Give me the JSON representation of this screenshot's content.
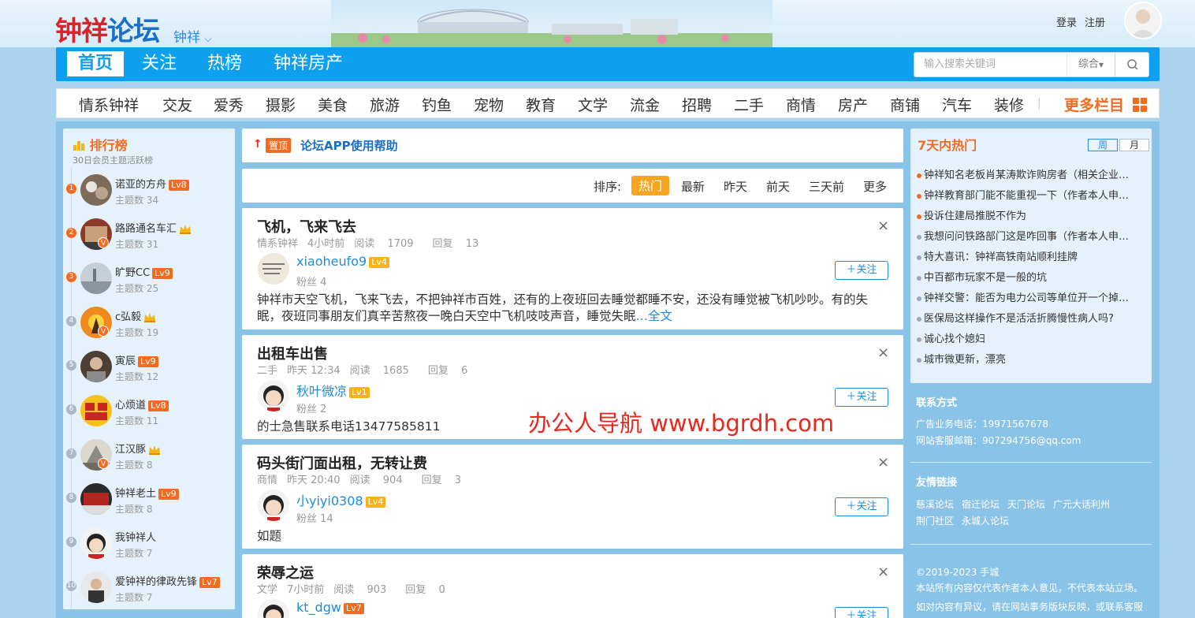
{
  "site": {
    "logo_a": "钟祥",
    "logo_b": "论坛",
    "city": "钟祥"
  },
  "user_links": {
    "login": "登录",
    "register": "注册"
  },
  "nav": {
    "items": [
      "首页",
      "关注",
      "热榜",
      "钟祥房产"
    ]
  },
  "search": {
    "placeholder": "输入搜索关键词",
    "scope": "综合"
  },
  "categories": [
    "情系钟祥",
    "交友",
    "爱秀",
    "摄影",
    "美食",
    "旅游",
    "钓鱼",
    "宠物",
    "教育",
    "文学",
    "流金",
    "招聘",
    "二手",
    "商情",
    "房产",
    "商铺",
    "汽车",
    "装修"
  ],
  "more_label": "更多栏目",
  "rank": {
    "title": "排行榜",
    "subtitle": "30日会员主题活跃榜",
    "count_label": "主题数",
    "items": [
      {
        "num": "1",
        "name": "诺亚的方舟",
        "lv": "Lv8",
        "count": "34"
      },
      {
        "num": "2",
        "name": "路路通名车汇",
        "lv": "",
        "count": "31"
      },
      {
        "num": "3",
        "name": "旷野CC",
        "lv": "Lv9",
        "count": "25"
      },
      {
        "num": "4",
        "name": "c弘毅",
        "lv": "",
        "count": "19"
      },
      {
        "num": "5",
        "name": "寅辰",
        "lv": "Lv9",
        "count": "12"
      },
      {
        "num": "6",
        "name": "心烦道",
        "lv": "Lv8",
        "count": "11"
      },
      {
        "num": "7",
        "name": "江汉豚",
        "lv": "",
        "count": "8"
      },
      {
        "num": "8",
        "name": "钟祥老土",
        "lv": "Lv9",
        "count": "8"
      },
      {
        "num": "9",
        "name": "我钟祥人",
        "lv": "",
        "count": "7"
      },
      {
        "num": "10",
        "name": "爱钟祥的律政先锋",
        "lv": "Lv7",
        "count": "7"
      }
    ]
  },
  "pinned": {
    "tag": "置顶",
    "title": "论坛APP使用帮助"
  },
  "sort": {
    "label": "排序:",
    "items": [
      "热门",
      "最新",
      "昨天",
      "前天",
      "三天前",
      "更多"
    ]
  },
  "follow_label": "关注",
  "fans_label": "粉丝",
  "read_label": "阅读",
  "reply_label": "回复",
  "posts": [
    {
      "title": "飞机，飞来飞去",
      "cat": "情系钟祥",
      "time": "4小时前",
      "reads": "1709",
      "replies": "13",
      "author": "xiaoheufo9",
      "lv": "Lv4",
      "fans": "4",
      "body": "钟祥市天空飞机，飞来飞去，不把钟祥市百姓，还有的上夜班回去睡觉都睡不安，还没有睡觉被飞机吵吵。有的失眠，夜班同事朋友们真辛苦熬夜一晚白天空中飞机吱吱声音，睡觉失眠",
      "ellipsis": "…",
      "more": "全文"
    },
    {
      "title": "出租车出售",
      "cat": "二手",
      "time": "昨天 12:34",
      "reads": "1685",
      "replies": "6",
      "author": "秋叶微凉",
      "lv": "Lv1",
      "fans": "2",
      "body": "的士急售联系电话13477585811"
    },
    {
      "title": "码头街门面出租，无转让费",
      "cat": "商情",
      "time": "昨天 20:40",
      "reads": "904",
      "replies": "3",
      "author": "小yiyi0308",
      "lv": "Lv4",
      "fans": "14",
      "body": "如题"
    },
    {
      "title": "荣辱之运",
      "cat": "文学",
      "time": "7小时前",
      "reads": "903",
      "replies": "0",
      "author": "kt_dgw",
      "lv": "Lv7",
      "fans": "",
      "body": ""
    }
  ],
  "watermark": "办公人导航 www.bgrdh.com",
  "hot": {
    "title": "7天内热门",
    "tabs": [
      "周",
      "月"
    ],
    "items": [
      "钟祥知名老板肖某涛欺诈购房者（相关企业…",
      "钟祥教育部门能不能重视一下（作者本人申…",
      "投诉住建局推脱不作为",
      "我想问问铁路部门这是咋回事（作者本人申…",
      "特大喜讯：钟祥高铁南站顺利挂牌",
      "中百都市玩家不是一般的坑",
      "钟祥交警：能否为电力公司等单位开一个掉…",
      "医保局这样操作不是活活折腾慢性病人吗?",
      "诚心找个媳妇",
      "城市微更新，漂亮"
    ]
  },
  "contact": {
    "title": "联系方式",
    "ad": "广告业务电话：19971567678",
    "email": "网站客服邮箱：907294756@qq.com"
  },
  "links": {
    "title": "友情链接",
    "items": [
      "慈溪论坛",
      "宿迁论坛",
      "天门论坛",
      "广元大话利州",
      "荆门社区",
      "永城人论坛"
    ]
  },
  "footer": {
    "copyright": "©2019-2023 手城",
    "disclaimer": "本站所有内容仅代表作者本人意见，不代表本站立场。",
    "notice": "如对内容有异议，请在网站事务版块反映，或联系客服"
  },
  "colors": {
    "primary": "#0ea0ee",
    "accent": "#f26b21",
    "link": "#1a8ce0"
  }
}
